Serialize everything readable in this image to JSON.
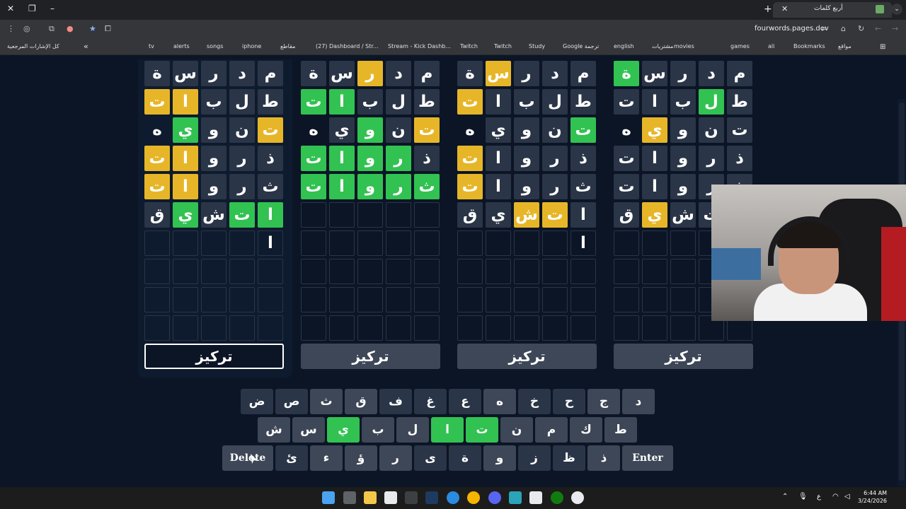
{
  "browser": {
    "tab_title": "أربع كلمات",
    "url": "fourwords.pages.dev",
    "bookmarks": [
      "كل الإشارات المرجعية",
      "tv",
      "alerts",
      "songs",
      "iphone",
      "مقاطع",
      "(27) Dashboard / Str...",
      "Stream - Kick Dashb...",
      "Twitch",
      "Twitch",
      "Study",
      "Google ترجمة",
      "english",
      "مشتريات",
      "movies",
      "games",
      "ali",
      "Bookmarks",
      "مواقع"
    ]
  },
  "boards": [
    {
      "rows": [
        [
          [
            "ة",
            "n"
          ],
          [
            "س",
            "n"
          ],
          [
            "ر",
            "n"
          ],
          [
            "د",
            "n"
          ],
          [
            "م",
            "n"
          ]
        ],
        [
          [
            "ت",
            "y"
          ],
          [
            "ا",
            "y"
          ],
          [
            "ب",
            "n"
          ],
          [
            "ل",
            "n"
          ],
          [
            "ط",
            "n"
          ]
        ],
        [
          [
            "ه",
            "e0"
          ],
          [
            "ي",
            "g"
          ],
          [
            "و",
            "n"
          ],
          [
            "ن",
            "n"
          ],
          [
            "ت",
            "y"
          ]
        ],
        [
          [
            "ت",
            "y"
          ],
          [
            "ا",
            "y"
          ],
          [
            "و",
            "n"
          ],
          [
            "ر",
            "n"
          ],
          [
            "ذ",
            "n"
          ]
        ],
        [
          [
            "ت",
            "y"
          ],
          [
            "ا",
            "y"
          ],
          [
            "و",
            "n"
          ],
          [
            "ر",
            "n"
          ],
          [
            "ث",
            "n"
          ]
        ],
        [
          [
            "ق",
            "n"
          ],
          [
            "ي",
            "g"
          ],
          [
            "ش",
            "n"
          ],
          [
            "ت",
            "g"
          ],
          [
            "ا",
            "g"
          ]
        ],
        [
          [
            "",
            "e"
          ],
          [
            "",
            "e"
          ],
          [
            "",
            "e"
          ],
          [
            "",
            "e"
          ],
          [
            "ا",
            "e"
          ]
        ],
        [
          [
            "",
            "e"
          ],
          [
            "",
            "e"
          ],
          [
            "",
            "e"
          ],
          [
            "",
            "e"
          ],
          [
            "",
            "e"
          ]
        ],
        [
          [
            "",
            "e"
          ],
          [
            "",
            "e"
          ],
          [
            "",
            "e"
          ],
          [
            "",
            "e"
          ],
          [
            "",
            "e"
          ]
        ],
        [
          [
            "",
            "e"
          ],
          [
            "",
            "e"
          ],
          [
            "",
            "e"
          ],
          [
            "",
            "e"
          ],
          [
            "",
            "e"
          ]
        ]
      ],
      "focus_label": "تركيز"
    },
    {
      "rows": [
        [
          [
            "ة",
            "n"
          ],
          [
            "س",
            "n"
          ],
          [
            "ر",
            "y"
          ],
          [
            "د",
            "n"
          ],
          [
            "م",
            "n"
          ]
        ],
        [
          [
            "ت",
            "g"
          ],
          [
            "ا",
            "g"
          ],
          [
            "ب",
            "n"
          ],
          [
            "ل",
            "n"
          ],
          [
            "ط",
            "n"
          ]
        ],
        [
          [
            "ه",
            "e0"
          ],
          [
            "ي",
            "n"
          ],
          [
            "و",
            "g"
          ],
          [
            "ن",
            "n"
          ],
          [
            "ت",
            "y"
          ]
        ],
        [
          [
            "ت",
            "g"
          ],
          [
            "ا",
            "g"
          ],
          [
            "و",
            "g"
          ],
          [
            "ر",
            "g"
          ],
          [
            "ذ",
            "n"
          ]
        ],
        [
          [
            "ت",
            "g"
          ],
          [
            "ا",
            "g"
          ],
          [
            "و",
            "g"
          ],
          [
            "ر",
            "g"
          ],
          [
            "ث",
            "g"
          ]
        ],
        [
          [
            "",
            "e"
          ],
          [
            "",
            "e"
          ],
          [
            "",
            "e"
          ],
          [
            "",
            "e"
          ],
          [
            "",
            "e"
          ]
        ],
        [
          [
            "",
            "e"
          ],
          [
            "",
            "e"
          ],
          [
            "",
            "e"
          ],
          [
            "",
            "e"
          ],
          [
            "",
            "e"
          ]
        ],
        [
          [
            "",
            "e"
          ],
          [
            "",
            "e"
          ],
          [
            "",
            "e"
          ],
          [
            "",
            "e"
          ],
          [
            "",
            "e"
          ]
        ],
        [
          [
            "",
            "e"
          ],
          [
            "",
            "e"
          ],
          [
            "",
            "e"
          ],
          [
            "",
            "e"
          ],
          [
            "",
            "e"
          ]
        ],
        [
          [
            "",
            "e"
          ],
          [
            "",
            "e"
          ],
          [
            "",
            "e"
          ],
          [
            "",
            "e"
          ],
          [
            "",
            "e"
          ]
        ]
      ],
      "focus_label": "تركيز"
    },
    {
      "rows": [
        [
          [
            "ة",
            "n"
          ],
          [
            "س",
            "y"
          ],
          [
            "ر",
            "n"
          ],
          [
            "د",
            "n"
          ],
          [
            "م",
            "n"
          ]
        ],
        [
          [
            "ت",
            "y"
          ],
          [
            "ا",
            "n"
          ],
          [
            "ب",
            "n"
          ],
          [
            "ل",
            "n"
          ],
          [
            "ط",
            "n"
          ]
        ],
        [
          [
            "ه",
            "e0"
          ],
          [
            "ي",
            "n"
          ],
          [
            "و",
            "n"
          ],
          [
            "ن",
            "n"
          ],
          [
            "ت",
            "g"
          ]
        ],
        [
          [
            "ت",
            "y"
          ],
          [
            "ا",
            "n"
          ],
          [
            "و",
            "n"
          ],
          [
            "ر",
            "n"
          ],
          [
            "ذ",
            "n"
          ]
        ],
        [
          [
            "ت",
            "y"
          ],
          [
            "ا",
            "n"
          ],
          [
            "و",
            "n"
          ],
          [
            "ر",
            "n"
          ],
          [
            "ث",
            "n"
          ]
        ],
        [
          [
            "ق",
            "n"
          ],
          [
            "ي",
            "n"
          ],
          [
            "ش",
            "y"
          ],
          [
            "ت",
            "y"
          ],
          [
            "ا",
            "n"
          ]
        ],
        [
          [
            "",
            "e"
          ],
          [
            "",
            "e"
          ],
          [
            "",
            "e"
          ],
          [
            "",
            "e"
          ],
          [
            "ا",
            "e"
          ]
        ],
        [
          [
            "",
            "e"
          ],
          [
            "",
            "e"
          ],
          [
            "",
            "e"
          ],
          [
            "",
            "e"
          ],
          [
            "",
            "e"
          ]
        ],
        [
          [
            "",
            "e"
          ],
          [
            "",
            "e"
          ],
          [
            "",
            "e"
          ],
          [
            "",
            "e"
          ],
          [
            "",
            "e"
          ]
        ],
        [
          [
            "",
            "e"
          ],
          [
            "",
            "e"
          ],
          [
            "",
            "e"
          ],
          [
            "",
            "e"
          ],
          [
            "",
            "e"
          ]
        ]
      ],
      "focus_label": "تركيز"
    },
    {
      "rows": [
        [
          [
            "ة",
            "g"
          ],
          [
            "س",
            "n"
          ],
          [
            "ر",
            "n"
          ],
          [
            "د",
            "n"
          ],
          [
            "م",
            "n"
          ]
        ],
        [
          [
            "ت",
            "n"
          ],
          [
            "ا",
            "n"
          ],
          [
            "ب",
            "n"
          ],
          [
            "ل",
            "g"
          ],
          [
            "ط",
            "n"
          ]
        ],
        [
          [
            "ه",
            "e0"
          ],
          [
            "ي",
            "y"
          ],
          [
            "و",
            "n"
          ],
          [
            "ن",
            "n"
          ],
          [
            "ت",
            "n"
          ]
        ],
        [
          [
            "ت",
            "n"
          ],
          [
            "ا",
            "n"
          ],
          [
            "و",
            "n"
          ],
          [
            "ر",
            "n"
          ],
          [
            "ذ",
            "n"
          ]
        ],
        [
          [
            "ت",
            "n"
          ],
          [
            "ا",
            "n"
          ],
          [
            "و",
            "n"
          ],
          [
            "ر",
            "n"
          ],
          [
            "ث",
            "n"
          ]
        ],
        [
          [
            "ق",
            "n"
          ],
          [
            "ي",
            "y"
          ],
          [
            "ش",
            "n"
          ],
          [
            "ت",
            "n"
          ],
          [
            "ا",
            "n"
          ]
        ],
        [
          [
            "",
            "e"
          ],
          [
            "",
            "e"
          ],
          [
            "",
            "e"
          ],
          [
            "",
            "e"
          ],
          [
            "",
            "e"
          ]
        ],
        [
          [
            "",
            "e"
          ],
          [
            "",
            "e"
          ],
          [
            "",
            "e"
          ],
          [
            "",
            "e"
          ],
          [
            "",
            "e"
          ]
        ],
        [
          [
            "",
            "e"
          ],
          [
            "",
            "e"
          ],
          [
            "",
            "e"
          ],
          [
            "",
            "e"
          ],
          [
            "",
            "e"
          ]
        ],
        [
          [
            "",
            "e"
          ],
          [
            "",
            "e"
          ],
          [
            "",
            "e"
          ],
          [
            "",
            "e"
          ],
          [
            "",
            "e"
          ]
        ]
      ],
      "focus_label": "تركيز"
    }
  ],
  "keyboard": {
    "row1": [
      [
        "ض",
        "n0"
      ],
      [
        "ص",
        "n0"
      ],
      [
        "ث",
        "n"
      ],
      [
        "ق",
        "n"
      ],
      [
        "ف",
        "n0"
      ],
      [
        "غ",
        "n0"
      ],
      [
        "ع",
        "n0"
      ],
      [
        "ه",
        "n"
      ],
      [
        "خ",
        "n0"
      ],
      [
        "ح",
        "n0"
      ],
      [
        "ج",
        "n"
      ],
      [
        "د",
        "n"
      ]
    ],
    "row2": [
      [
        "ش",
        "n"
      ],
      [
        "س",
        "n"
      ],
      [
        "ي",
        "g"
      ],
      [
        "ب",
        "n"
      ],
      [
        "ل",
        "n"
      ],
      [
        "ا",
        "g"
      ],
      [
        "ت",
        "g"
      ],
      [
        "ن",
        "n"
      ],
      [
        "م",
        "n"
      ],
      [
        "ك",
        "k"
      ],
      [
        "ط",
        "n"
      ]
    ],
    "row3": [
      [
        "Delete",
        "w"
      ],
      [
        "ئ",
        "n0"
      ],
      [
        "ء",
        "n"
      ],
      [
        "ؤ",
        "n"
      ],
      [
        "ر",
        "n"
      ],
      [
        "ى",
        "n0"
      ],
      [
        "ة",
        "n0"
      ],
      [
        "و",
        "n"
      ],
      [
        "ز",
        "n0"
      ],
      [
        "ظ",
        "n0"
      ],
      [
        "ذ",
        "n"
      ],
      [
        "Enter",
        "w"
      ]
    ]
  },
  "taskbar": {
    "clock_time": "6:44 AM",
    "clock_date": "3/24/2026",
    "lang": "ع"
  },
  "colors": {
    "correct": "#31c251",
    "present": "#e7b628",
    "absent": "#2a3547",
    "key": "#3e4757",
    "background": "#0b1526"
  }
}
